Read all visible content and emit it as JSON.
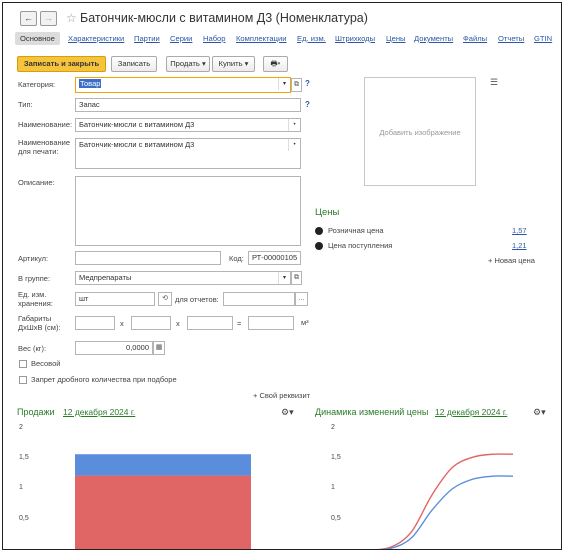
{
  "window": {
    "title": "Батончик-мюсли с витамином Д3 (Номенклатура)",
    "back": "←",
    "forward": "→"
  },
  "tabs": [
    "Основное",
    "Характеристики",
    "Партии",
    "Серии",
    "Набор",
    "Комплектации",
    "Ед. изм.",
    "Штрихкоды",
    "Цены",
    "Документы",
    "Файлы",
    "Отчеты",
    "GTIN"
  ],
  "toolbar": {
    "save_close": "Записать и закрыть",
    "save": "Записать",
    "sell": "Продать",
    "buy": "Купить"
  },
  "form": {
    "category_label": "Категория:",
    "category_value": "Товар",
    "type_label": "Тип:",
    "type_value": "Запас",
    "name_label": "Наименование:",
    "name_value": "Батончик-мюсли с витамином Д3",
    "print_name_label_1": "Наименование",
    "print_name_label_2": "для печати:",
    "print_name_value": "Батончик-мюсли с витамином Д3",
    "description_label": "Описание:",
    "add_image": "Добавить изображение",
    "article_label": "Артикул:",
    "article_value": "",
    "code_label": "Код:",
    "code_value": "РТ-00000105",
    "group_label": "В группе:",
    "group_value": "Медпрепараты",
    "unit_label_1": "Ед. изм.",
    "unit_label_2": "хранения:",
    "unit_value": "шт",
    "reports_label": "для отчетов:",
    "dims_label_1": "Габариты",
    "dims_label_2": "ДхШхВ (см):",
    "x1": "x",
    "x2": "x",
    "eq": "=",
    "m3": "м³",
    "weight_label": "Вес (кг):",
    "weight_value": "0,0000",
    "weighted_label": "Весовой",
    "fractional_label": "Запрет дробного количества при подборе",
    "own_attr": "+ Свой реквизит",
    "question": "?"
  },
  "prices": {
    "title": "Цены",
    "rows": [
      {
        "name": "Розничная цена",
        "value": "1,57"
      },
      {
        "name": "Цена поступления",
        "value": "1,21"
      }
    ],
    "new_price": "+ Новая цена"
  },
  "sales_chart": {
    "title": "Продажи",
    "date": "12 декабря 2024 г.",
    "ticks": [
      "2",
      "1,5",
      "1",
      "0,5"
    ]
  },
  "price_chart": {
    "title": "Динамика изменений цены",
    "date": "12 декабря 2024 г.",
    "ticks": [
      "2",
      "1,5",
      "1",
      "0,5"
    ]
  },
  "chart_data": [
    {
      "type": "bar",
      "title": "Продажи",
      "categories": [
        ""
      ],
      "series": [
        {
          "color": "#e06666",
          "values": [
            1.22
          ]
        },
        {
          "color": "#5b8ddd",
          "values": [
            0.35
          ]
        }
      ],
      "ylim": [
        0,
        2
      ],
      "yticks": [
        0.5,
        1,
        1.5,
        2
      ]
    },
    {
      "type": "line",
      "title": "Динамика изменений цены",
      "ylim": [
        0,
        2
      ],
      "yticks": [
        0.5,
        1,
        1.5,
        2
      ],
      "series": [
        {
          "color": "#e06666",
          "values": [
            0.0,
            0.05,
            0.3,
            0.9,
            1.35,
            1.52,
            1.57,
            1.57
          ]
        },
        {
          "color": "#5b8ddd",
          "values": [
            0.0,
            0.03,
            0.2,
            0.65,
            1.0,
            1.16,
            1.21,
            1.21
          ]
        }
      ]
    }
  ],
  "colors": {
    "accent": "#f6c43c",
    "link": "#2a58a6",
    "green": "#2a7a2a",
    "bar_red": "#e06666",
    "bar_blue": "#5b8ddd"
  }
}
